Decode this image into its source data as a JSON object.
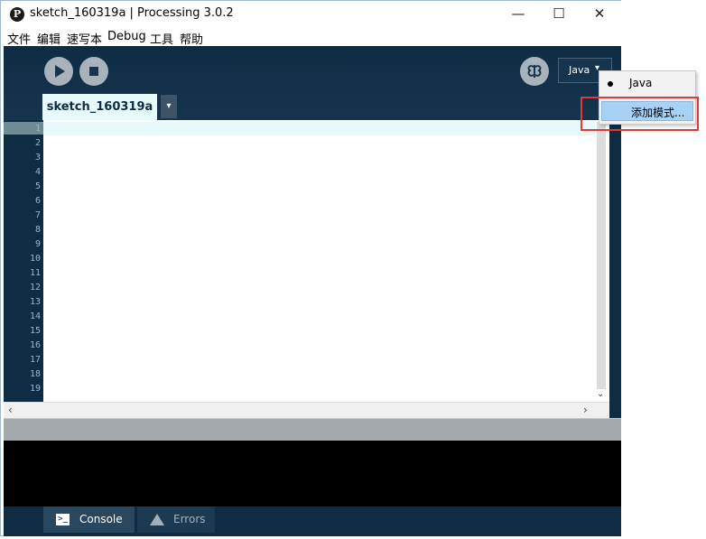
{
  "window": {
    "title": "sketch_160319a | Processing 3.0.2",
    "logo_letter": "P",
    "controls": {
      "minimize": "—",
      "maximize": "☐",
      "close": "✕"
    }
  },
  "menu": [
    "文件",
    "编辑",
    "速写本",
    "Debug",
    "工具",
    "帮助"
  ],
  "toolbar": {
    "run_icon": "play-icon",
    "stop_icon": "stop-icon",
    "debug_icon": "debugger-butterfly-icon",
    "mode_selected": "Java",
    "mode_arrow": "▾"
  },
  "tabs": [
    {
      "label": "sketch_160319a",
      "active": true
    }
  ],
  "tab_menu_arrow": "▾",
  "editor": {
    "line_numbers": [
      "1",
      "2",
      "3",
      "4",
      "5",
      "6",
      "7",
      "8",
      "9",
      "10",
      "11",
      "12",
      "13",
      "14",
      "15",
      "16",
      "17",
      "18",
      "19"
    ],
    "current_line": "1",
    "content": ""
  },
  "scroll_arrows": {
    "down": "⌄",
    "left": "‹",
    "right": "›"
  },
  "mode_dropdown": {
    "items": [
      {
        "label": "Java",
        "selected": true
      },
      {
        "label": "添加模式...",
        "highlighted": true
      }
    ]
  },
  "footer": {
    "console_tab": "Console",
    "console_icon_glyph": ">_",
    "errors_tab": "Errors"
  },
  "colors": {
    "frame": "#0e2c44",
    "tab_active": "#e6fafb",
    "highlight_box": "#e53935",
    "popup_highlight": "#a7d2f5"
  }
}
